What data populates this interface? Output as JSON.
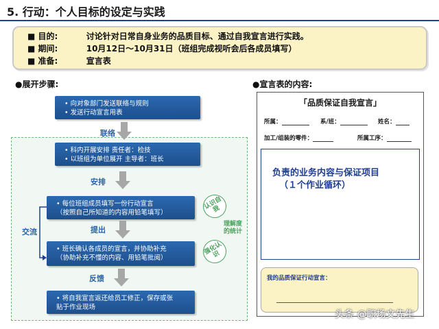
{
  "title": "5. 行动：个人目标的设定与实践",
  "goals": {
    "rows": [
      {
        "bullet": "■",
        "label": "目的:",
        "value": "讨论针对日常自身业务的品质目标、通过自我宣言进行实践。"
      },
      {
        "bullet": "■",
        "label": "期间:",
        "value": "10月12日～10月31日（班组完成视听会后各成员填写）"
      },
      {
        "bullet": "■",
        "label": "准备:",
        "value": "宣言表"
      }
    ]
  },
  "left_heading": "●展开步骤:",
  "right_heading": "●宣言表的内容:",
  "steps": [
    {
      "lines": [
        "• 向对象部门发送联络与规则",
        "• 发送行动宣言用表"
      ]
    },
    {
      "lines": [
        "• 科内开展安排   责任者：检技",
        "• 以班组为单位展开   主导者：班长"
      ]
    },
    {
      "lines": [
        "• 每位班组成员填写一份行动宣言",
        "（按照自己所知道的内容用铅笔填写）"
      ]
    },
    {
      "lines": [
        "• 班长确认各成员的宣言，并协助补充",
        "（协助补充不懂的内容、用铅笔批阅）"
      ]
    },
    {
      "lines": [
        "• 将自我宣言返还给员工修正，保存或张",
        "贴于作业现场"
      ]
    }
  ],
  "arrows": [
    "联络",
    "安排",
    "提出",
    "反馈"
  ],
  "side_label": "交流",
  "ovals": [
    "认识自我",
    "强化认识"
  ],
  "stat_note": [
    "理解度",
    "的统计"
  ],
  "declaration": {
    "title": "「品质保证自我宣言」",
    "field_belong": "所属：",
    "field_class": "系/班：",
    "field_name": "姓名：",
    "field_parts": "加工/组装的零件：",
    "field_process": "所属工序：",
    "resp_lines": [
      "负责的业务内容与保证项目",
      "（１个作业循环）"
    ],
    "pledge_label": "我的品质保证行动宣言："
  },
  "watermark": "头条 @职场文先生",
  "colors": {
    "accent": "#1f3f8f",
    "step": "#2b69b0",
    "green": "#49a15b",
    "goal_bg": "#fbf3c6"
  }
}
